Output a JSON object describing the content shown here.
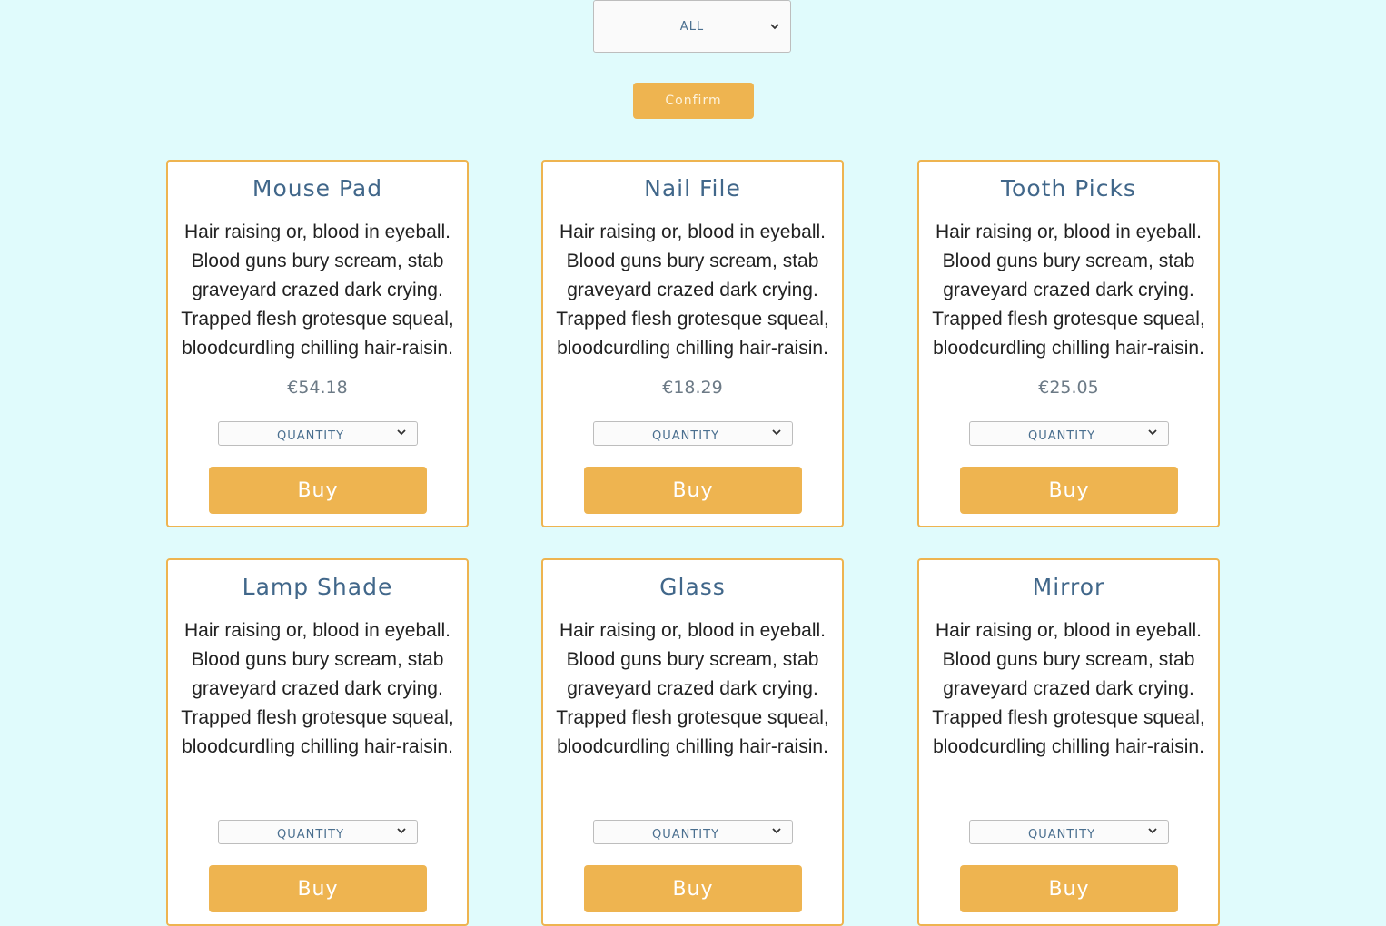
{
  "filter": {
    "selected": "ALL"
  },
  "confirm_label": "Confirm",
  "products": [
    {
      "name": "Mouse Pad",
      "description": "Hair raising or, blood in eyeball. Blood guns bury scream, stab graveyard crazed dark crying. Trapped flesh grotesque squeal, bloodcurdling chilling hair-raisin.",
      "price": "€54.18",
      "quantity_placeholder": "QUANTITY",
      "buy_label": "Buy"
    },
    {
      "name": "Nail File",
      "description": "Hair raising or, blood in eyeball. Blood guns bury scream, stab graveyard crazed dark crying. Trapped flesh grotesque squeal, bloodcurdling chilling hair-raisin.",
      "price": "€18.29",
      "quantity_placeholder": "QUANTITY",
      "buy_label": "Buy"
    },
    {
      "name": "Tooth Picks",
      "description": "Hair raising or, blood in eyeball. Blood guns bury scream, stab graveyard crazed dark crying. Trapped flesh grotesque squeal, bloodcurdling chilling hair-raisin.",
      "price": "€25.05",
      "quantity_placeholder": "QUANTITY",
      "buy_label": "Buy"
    },
    {
      "name": "Lamp Shade",
      "description": "Hair raising or, blood in eyeball. Blood guns bury scream, stab graveyard crazed dark crying. Trapped flesh grotesque squeal, bloodcurdling chilling hair-raisin.",
      "price": "",
      "quantity_placeholder": "QUANTITY",
      "buy_label": "Buy"
    },
    {
      "name": "Glass",
      "description": "Hair raising or, blood in eyeball. Blood guns bury scream, stab graveyard crazed dark crying. Trapped flesh grotesque squeal, bloodcurdling chilling hair-raisin.",
      "price": "",
      "quantity_placeholder": "QUANTITY",
      "buy_label": "Buy"
    },
    {
      "name": "Mirror",
      "description": "Hair raising or, blood in eyeball. Blood guns bury scream, stab graveyard crazed dark crying. Trapped flesh grotesque squeal, bloodcurdling chilling hair-raisin.",
      "price": "",
      "quantity_placeholder": "QUANTITY",
      "buy_label": "Buy"
    }
  ],
  "colors": {
    "background": "#e0fbfc",
    "accent": "#eeb450",
    "title": "#41678a"
  },
  "icons": {
    "select_arrow": "chevron-down-icon"
  }
}
